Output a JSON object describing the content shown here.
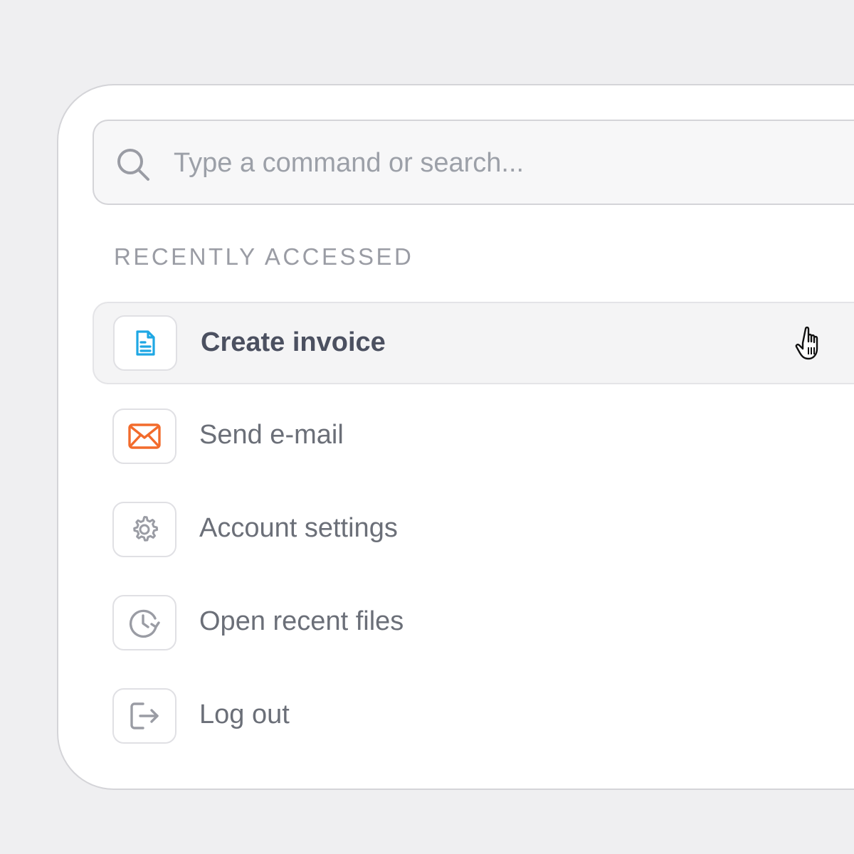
{
  "search": {
    "placeholder": "Type a command or search...",
    "value": "",
    "icon": "search-icon"
  },
  "section": {
    "label": "RECENTLY ACCESSED"
  },
  "items": [
    {
      "label": "Create invoice",
      "icon": "document-icon",
      "icon_color": "#1ea7e4",
      "active": true
    },
    {
      "label": "Send e-mail",
      "icon": "envelope-icon",
      "icon_color": "#f26b2c",
      "active": false
    },
    {
      "label": "Account settings",
      "icon": "gear-icon",
      "icon_color": "#9a9ca4",
      "active": false
    },
    {
      "label": "Open recent files",
      "icon": "clock-history-icon",
      "icon_color": "#9a9ca4",
      "active": false
    },
    {
      "label": "Log out",
      "icon": "logout-icon",
      "icon_color": "#9a9ca4",
      "active": false
    }
  ],
  "colors": {
    "background": "#efeff1",
    "panel": "#ffffff",
    "hover_row": "#f4f4f5",
    "label_text": "#6b6f78",
    "muted_text": "#9a9ca4"
  },
  "pointer": "hand-pointer-icon"
}
